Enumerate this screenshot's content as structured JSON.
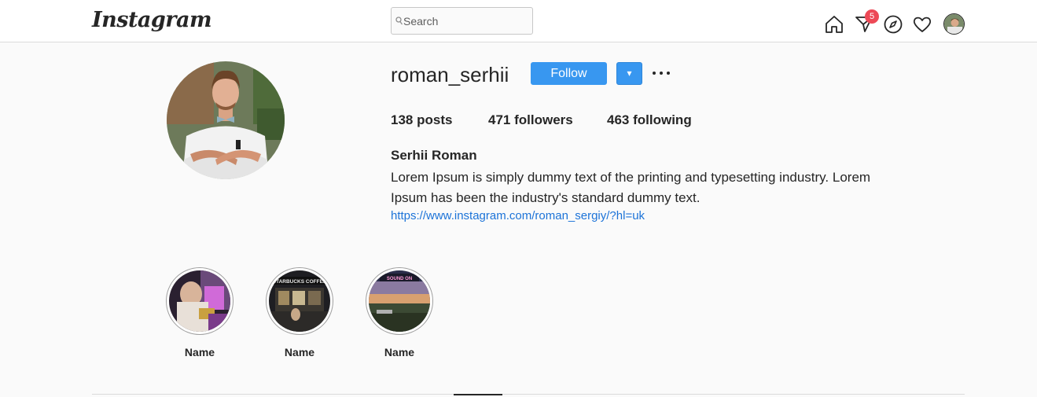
{
  "header": {
    "logo": "Instagram",
    "search_placeholder": "Search",
    "notification_count": "5"
  },
  "profile": {
    "username": "roman_serhii",
    "follow_label": "Follow",
    "dropdown_label": "▾",
    "posts": "138",
    "posts_label": "posts",
    "followers": "471",
    "followers_label": "followers",
    "following": "463",
    "following_label": "following",
    "full_name": "Serhii Roman",
    "bio_line1": "Lorem Ipsum is simply dummy text of the printing and typesetting industry. Lorem",
    "bio_line2": "Ipsum has been the industry's standard dummy text.",
    "link": "https://www.instagram.com/roman_sergiy/?hl=uk"
  },
  "highlights": [
    {
      "name": "Name",
      "image": "bar-scene"
    },
    {
      "name": "Name",
      "image": "starbucks-coffee",
      "sign_text": "STARBUCKS COFFEE"
    },
    {
      "name": "Name",
      "image": "sunset-landscape",
      "sign_text": "SOUND ON"
    }
  ],
  "colors": {
    "accent": "#3897f0",
    "link": "#1c73d8",
    "badge": "#ed4956",
    "background": "#fafafa"
  }
}
